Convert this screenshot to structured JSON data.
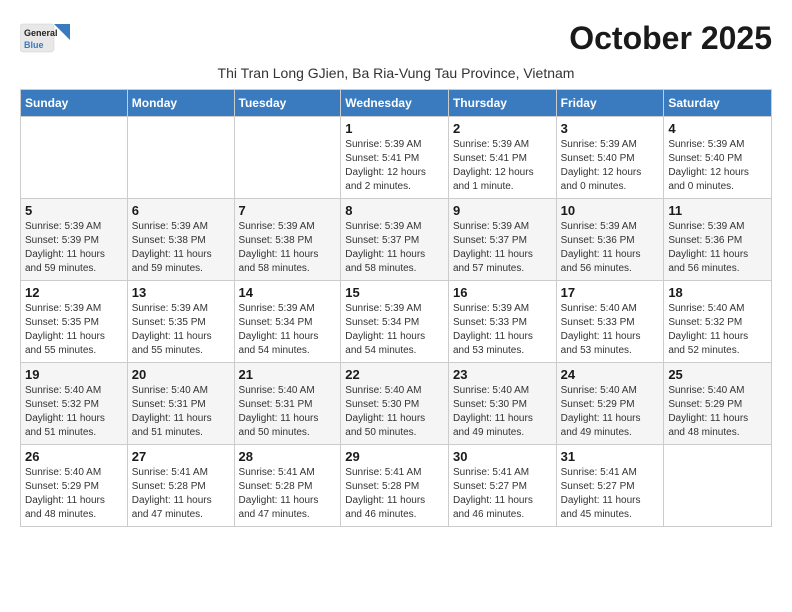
{
  "header": {
    "logo_general": "General",
    "logo_blue": "Blue",
    "month_title": "October 2025",
    "subtitle": "Thi Tran Long GJien, Ba Ria-Vung Tau Province, Vietnam"
  },
  "columns": [
    "Sunday",
    "Monday",
    "Tuesday",
    "Wednesday",
    "Thursday",
    "Friday",
    "Saturday"
  ],
  "weeks": [
    {
      "days": [
        {
          "num": "",
          "info": ""
        },
        {
          "num": "",
          "info": ""
        },
        {
          "num": "",
          "info": ""
        },
        {
          "num": "1",
          "info": "Sunrise: 5:39 AM\nSunset: 5:41 PM\nDaylight: 12 hours\nand 2 minutes."
        },
        {
          "num": "2",
          "info": "Sunrise: 5:39 AM\nSunset: 5:41 PM\nDaylight: 12 hours\nand 1 minute."
        },
        {
          "num": "3",
          "info": "Sunrise: 5:39 AM\nSunset: 5:40 PM\nDaylight: 12 hours\nand 0 minutes."
        },
        {
          "num": "4",
          "info": "Sunrise: 5:39 AM\nSunset: 5:40 PM\nDaylight: 12 hours\nand 0 minutes."
        }
      ]
    },
    {
      "days": [
        {
          "num": "5",
          "info": "Sunrise: 5:39 AM\nSunset: 5:39 PM\nDaylight: 11 hours\nand 59 minutes."
        },
        {
          "num": "6",
          "info": "Sunrise: 5:39 AM\nSunset: 5:38 PM\nDaylight: 11 hours\nand 59 minutes."
        },
        {
          "num": "7",
          "info": "Sunrise: 5:39 AM\nSunset: 5:38 PM\nDaylight: 11 hours\nand 58 minutes."
        },
        {
          "num": "8",
          "info": "Sunrise: 5:39 AM\nSunset: 5:37 PM\nDaylight: 11 hours\nand 58 minutes."
        },
        {
          "num": "9",
          "info": "Sunrise: 5:39 AM\nSunset: 5:37 PM\nDaylight: 11 hours\nand 57 minutes."
        },
        {
          "num": "10",
          "info": "Sunrise: 5:39 AM\nSunset: 5:36 PM\nDaylight: 11 hours\nand 56 minutes."
        },
        {
          "num": "11",
          "info": "Sunrise: 5:39 AM\nSunset: 5:36 PM\nDaylight: 11 hours\nand 56 minutes."
        }
      ]
    },
    {
      "days": [
        {
          "num": "12",
          "info": "Sunrise: 5:39 AM\nSunset: 5:35 PM\nDaylight: 11 hours\nand 55 minutes."
        },
        {
          "num": "13",
          "info": "Sunrise: 5:39 AM\nSunset: 5:35 PM\nDaylight: 11 hours\nand 55 minutes."
        },
        {
          "num": "14",
          "info": "Sunrise: 5:39 AM\nSunset: 5:34 PM\nDaylight: 11 hours\nand 54 minutes."
        },
        {
          "num": "15",
          "info": "Sunrise: 5:39 AM\nSunset: 5:34 PM\nDaylight: 11 hours\nand 54 minutes."
        },
        {
          "num": "16",
          "info": "Sunrise: 5:39 AM\nSunset: 5:33 PM\nDaylight: 11 hours\nand 53 minutes."
        },
        {
          "num": "17",
          "info": "Sunrise: 5:40 AM\nSunset: 5:33 PM\nDaylight: 11 hours\nand 53 minutes."
        },
        {
          "num": "18",
          "info": "Sunrise: 5:40 AM\nSunset: 5:32 PM\nDaylight: 11 hours\nand 52 minutes."
        }
      ]
    },
    {
      "days": [
        {
          "num": "19",
          "info": "Sunrise: 5:40 AM\nSunset: 5:32 PM\nDaylight: 11 hours\nand 51 minutes."
        },
        {
          "num": "20",
          "info": "Sunrise: 5:40 AM\nSunset: 5:31 PM\nDaylight: 11 hours\nand 51 minutes."
        },
        {
          "num": "21",
          "info": "Sunrise: 5:40 AM\nSunset: 5:31 PM\nDaylight: 11 hours\nand 50 minutes."
        },
        {
          "num": "22",
          "info": "Sunrise: 5:40 AM\nSunset: 5:30 PM\nDaylight: 11 hours\nand 50 minutes."
        },
        {
          "num": "23",
          "info": "Sunrise: 5:40 AM\nSunset: 5:30 PM\nDaylight: 11 hours\nand 49 minutes."
        },
        {
          "num": "24",
          "info": "Sunrise: 5:40 AM\nSunset: 5:29 PM\nDaylight: 11 hours\nand 49 minutes."
        },
        {
          "num": "25",
          "info": "Sunrise: 5:40 AM\nSunset: 5:29 PM\nDaylight: 11 hours\nand 48 minutes."
        }
      ]
    },
    {
      "days": [
        {
          "num": "26",
          "info": "Sunrise: 5:40 AM\nSunset: 5:29 PM\nDaylight: 11 hours\nand 48 minutes."
        },
        {
          "num": "27",
          "info": "Sunrise: 5:41 AM\nSunset: 5:28 PM\nDaylight: 11 hours\nand 47 minutes."
        },
        {
          "num": "28",
          "info": "Sunrise: 5:41 AM\nSunset: 5:28 PM\nDaylight: 11 hours\nand 47 minutes."
        },
        {
          "num": "29",
          "info": "Sunrise: 5:41 AM\nSunset: 5:28 PM\nDaylight: 11 hours\nand 46 minutes."
        },
        {
          "num": "30",
          "info": "Sunrise: 5:41 AM\nSunset: 5:27 PM\nDaylight: 11 hours\nand 46 minutes."
        },
        {
          "num": "31",
          "info": "Sunrise: 5:41 AM\nSunset: 5:27 PM\nDaylight: 11 hours\nand 45 minutes."
        },
        {
          "num": "",
          "info": ""
        }
      ]
    }
  ]
}
